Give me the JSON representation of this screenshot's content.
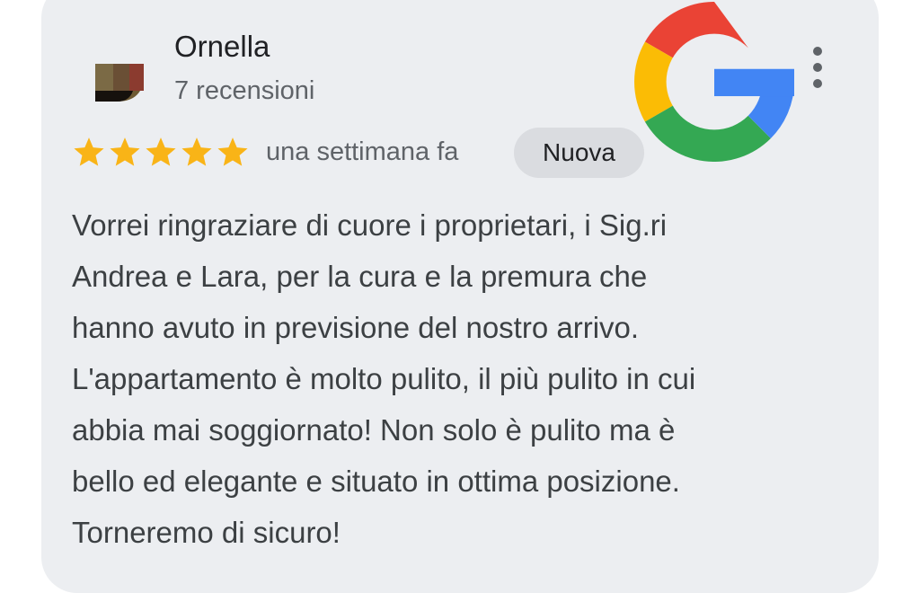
{
  "review": {
    "author": "Ornella",
    "reviews_count": "7 recensioni",
    "rating": 5,
    "rating_max": 5,
    "time_ago": "una settimana fa",
    "badge": "Nuova",
    "text_lines": [
      "Vorrei ringraziare di cuore i proprietari, i Sig.ri",
      "Andrea e Lara, per la cura e la premura che",
      "hanno avuto in previsione del nostro arrivo.",
      "L'appartamento è molto pulito, il più pulito in cui",
      "abbia mai soggiornato! Non solo è pulito ma è",
      "bello ed elegante e situato in ottima posizione.",
      "Torneremo di sicuro!"
    ]
  },
  "icons": {
    "brand_logo": "google-g-icon",
    "more": "more-vert-icon",
    "star": "star-icon"
  },
  "colors": {
    "card_background": "#eceef1",
    "star": "#f9b417",
    "badge_background": "#dadce0",
    "google_red": "#ea4335",
    "google_yellow": "#fbbc05",
    "google_green": "#34a853",
    "google_blue": "#4285f4"
  }
}
